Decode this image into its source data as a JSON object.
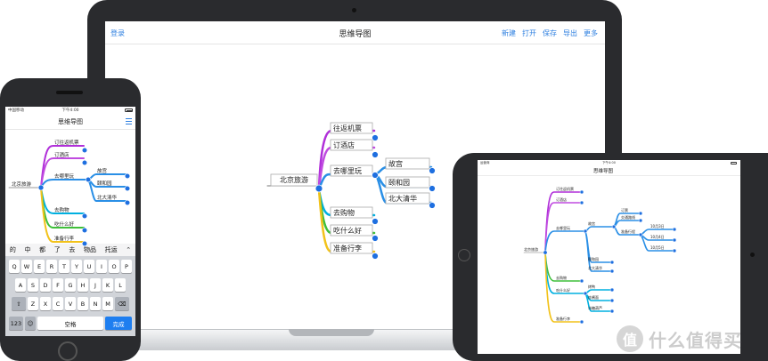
{
  "laptop": {
    "toolbar": {
      "login": "登录",
      "title": "思维导图",
      "menu": [
        "新建",
        "打开",
        "保存",
        "导出",
        "更多"
      ]
    },
    "mindmap": {
      "root": "北京旅游",
      "topics": [
        "往返机票",
        "订酒店",
        "去哪里玩",
        "去购物",
        "吃什么好",
        "准备行李"
      ],
      "places": [
        "故宫",
        "颐和园",
        "北大清华"
      ]
    }
  },
  "phone": {
    "status": {
      "carrier": "中国移动",
      "time": "下午4:00"
    },
    "title": "思维导图",
    "mindmap": {
      "root": "北京旅游",
      "topics": [
        "订往返机票",
        "订酒店",
        "去哪里玩",
        "去购物",
        "吃什么好",
        "准备行李"
      ],
      "places": [
        "故宫",
        "颐和园",
        "北大清华"
      ]
    },
    "keyboard": {
      "candidates": [
        "的",
        "中",
        "都",
        "了",
        "去",
        "物品",
        "托运"
      ],
      "row1": [
        "Q",
        "W",
        "E",
        "R",
        "T",
        "Y",
        "U",
        "I",
        "O",
        "P"
      ],
      "row2": [
        "A",
        "S",
        "D",
        "F",
        "G",
        "H",
        "J",
        "K",
        "L"
      ],
      "row3": [
        "Z",
        "X",
        "C",
        "V",
        "B",
        "N",
        "M"
      ],
      "numbers": "123",
      "space": "空格",
      "done": "完成"
    }
  },
  "tablet": {
    "status": {
      "carrier": "运营商",
      "time": "下午4:00"
    },
    "title": "思维导图",
    "mindmap": {
      "root": "北京旅游",
      "topics": [
        "订往返机票",
        "订酒店",
        "去哪里玩",
        "去购物",
        "吃什么好",
        "准备行李"
      ],
      "places": [
        "故宫",
        "颐和园",
        "北大清华"
      ],
      "transport": [
        "订票",
        "交通路线",
        "准备行程"
      ],
      "dates": [
        "10月3日",
        "10月4日",
        "10月5日"
      ],
      "foods": [
        "烤鸭",
        "炸酱面",
        "冰糖葫芦"
      ]
    }
  },
  "watermark": {
    "badge": "值",
    "text": "什么值得买"
  },
  "colors": {
    "purple": "#b02fd9",
    "blue": "#2a8fe6",
    "cyan": "#00b0e0",
    "green": "#3fbf3a",
    "yellow": "#f2c21a",
    "node": "#1e6fe0"
  }
}
